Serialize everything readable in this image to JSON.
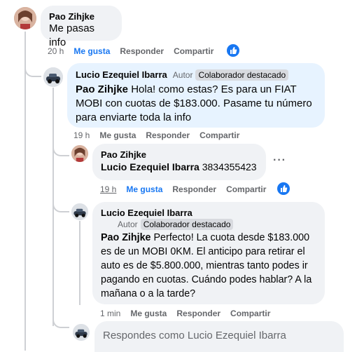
{
  "comment1": {
    "author": "Pao Zihjke",
    "text": "Me pasas info",
    "time": "20 h",
    "like": "Me gusta",
    "reply": "Responder",
    "share": "Compartir"
  },
  "comment2": {
    "author": "Lucio Ezequiel Ibarra",
    "role": "Autor",
    "badge": "Colaborador destacado",
    "mention": "Pao Zihjke",
    "text": " Hola! como estas? Es para un FIAT MOBI con cuotas de $183.000. Pasame tu número para enviarte toda la info",
    "time": "19 h",
    "like": "Me gusta",
    "reply": "Responder",
    "share": "Compartir"
  },
  "comment3": {
    "author": "Pao Zihjke",
    "mention": "Lucio Ezequiel Ibarra",
    "text": " 3834355423",
    "time": "19 h",
    "like": "Me gusta",
    "reply": "Responder",
    "share": "Compartir",
    "more": "···"
  },
  "comment4": {
    "author": "Lucio Ezequiel Ibarra",
    "role": "Autor",
    "badge": "Colaborador destacado",
    "mention": "Pao Zihjke",
    "text": " Perfecto! La cuota desde $183.000 es de un MOBI 0KM. El anticipo para retirar el auto es de $5.800.000, mientras tanto podes ir pagando en cuotas. Cuándo podes hablar? A la mañana o a la tarde?",
    "time": "1 min",
    "like": "Me gusta",
    "reply": "Responder",
    "share": "Compartir"
  },
  "reply_box": {
    "placeholder": "Respondes como Lucio Ezequiel Ibarra"
  },
  "colors": {
    "accent": "#1877f2",
    "bubble_gray": "#f0f2f5",
    "bubble_blue": "#e7f3ff",
    "muted": "#65676b"
  },
  "icons": {
    "like": "thumbs-up-icon",
    "more": "more-dots-icon"
  }
}
